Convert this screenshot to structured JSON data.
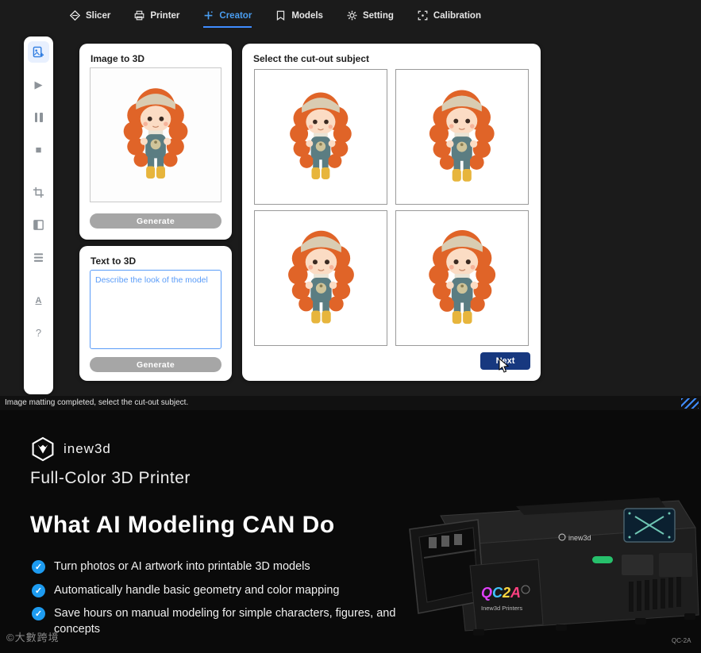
{
  "nav": {
    "tabs": [
      {
        "label": "Slicer",
        "icon": "slicer-icon"
      },
      {
        "label": "Printer",
        "icon": "printer-icon"
      },
      {
        "label": "Creator",
        "icon": "creator-icon"
      },
      {
        "label": "Models",
        "icon": "models-icon"
      },
      {
        "label": "Setting",
        "icon": "setting-icon"
      },
      {
        "label": "Calibration",
        "icon": "calibration-icon"
      }
    ],
    "active_tab": "Creator"
  },
  "sidebar": {
    "items": [
      {
        "name": "import-image",
        "active": true
      },
      {
        "name": "play",
        "glyph": "▶"
      },
      {
        "name": "pause"
      },
      {
        "name": "stop",
        "glyph": "■"
      },
      {
        "name": "crop"
      },
      {
        "name": "panel"
      },
      {
        "name": "queue"
      },
      {
        "name": "translate",
        "glyph": "A"
      },
      {
        "name": "help",
        "glyph": "?"
      }
    ]
  },
  "panels": {
    "image_to_3d": {
      "title": "Image to 3D",
      "generate_label": "Generate"
    },
    "text_to_3d": {
      "title": "Text to 3D",
      "placeholder": "Describe the look of the model",
      "generate_label": "Generate"
    },
    "cutout": {
      "title": "Select the cut-out subject",
      "next_label": "Next"
    }
  },
  "status_bar": {
    "message": "Image matting completed, select the cut-out subject."
  },
  "marketing": {
    "brand": "inew3d",
    "subtitle": "Full-Color 3D Printer",
    "headline": "What AI Modeling CAN Do",
    "check_glyph": "✓",
    "bullets": [
      "Turn photos or AI artwork into printable 3D models",
      "Automatically handle basic geometry and color mapping",
      "Save hours on manual modeling for simple characters, figures, and concepts"
    ],
    "watermark": "©大數跨境",
    "printer": {
      "label": "inew3d",
      "art": [
        "Q",
        "C",
        "2",
        "A"
      ],
      "caption": "Inew3d Printers",
      "model_code": "QC-2A"
    }
  },
  "colors": {
    "accent": "#4a9df0",
    "next_button": "#17387f",
    "check": "#1d9bf0",
    "generate_button": "#a6a6a6",
    "textarea_border": "#5a9cf8"
  }
}
